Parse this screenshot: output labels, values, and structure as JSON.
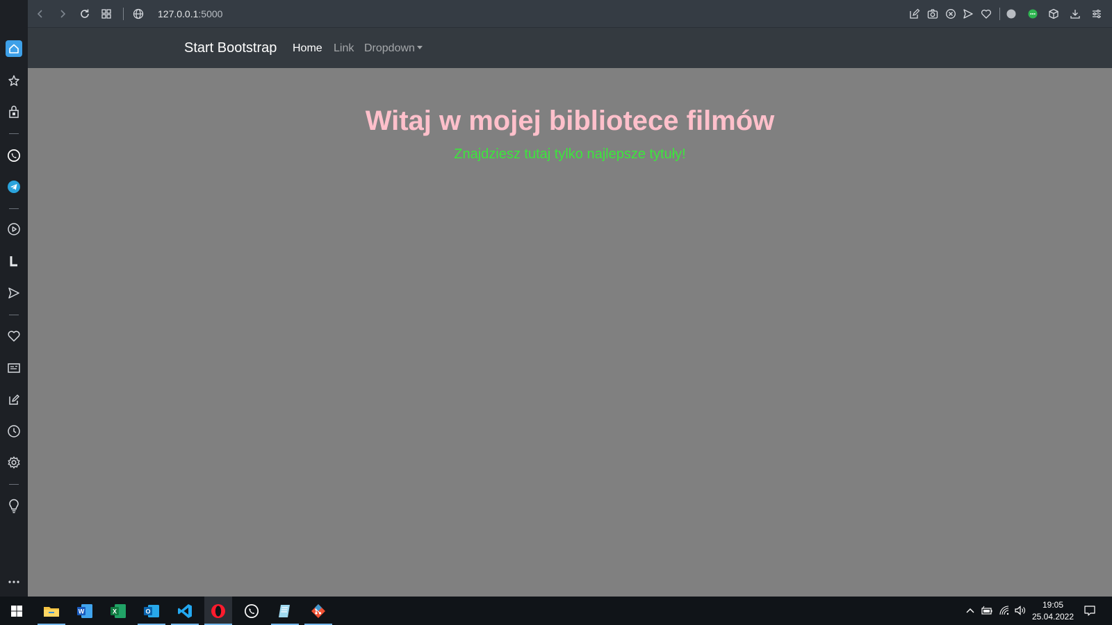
{
  "browser": {
    "url_host": "127.0.0.1",
    "url_port": ":5000"
  },
  "navbar": {
    "brand": "Start Bootstrap",
    "links": [
      {
        "label": "Home",
        "active": true
      },
      {
        "label": "Link",
        "active": false
      },
      {
        "label": "Dropdown",
        "active": false
      }
    ]
  },
  "hero": {
    "title": "Witaj w mojej bibliotece filmów",
    "subtitle": "Znajdziesz tutaj tylko najlepsze tytuły!"
  },
  "sidebar": {
    "items": [
      "home-icon",
      "bookmarks-icon",
      "wallet-icon",
      "whatsapp-icon",
      "telegram-icon",
      "player-icon",
      "l-icon",
      "send-icon",
      "heart-icon",
      "news-icon",
      "edit-icon",
      "history-icon",
      "settings-icon",
      "tips-icon",
      "more-icon"
    ]
  },
  "taskbar": {
    "apps": [
      "file-explorer-icon",
      "word-icon",
      "excel-icon",
      "outlook-icon",
      "vscode-icon",
      "opera-icon",
      "whatsapp-icon",
      "notepad-icon",
      "git-icon"
    ],
    "time": "19:05",
    "date": "25.04.2022"
  },
  "colors": {
    "title": "#ffc0cb",
    "subtitle": "#3ce63c",
    "page_background": "#808080",
    "navbar": "#343a40"
  }
}
